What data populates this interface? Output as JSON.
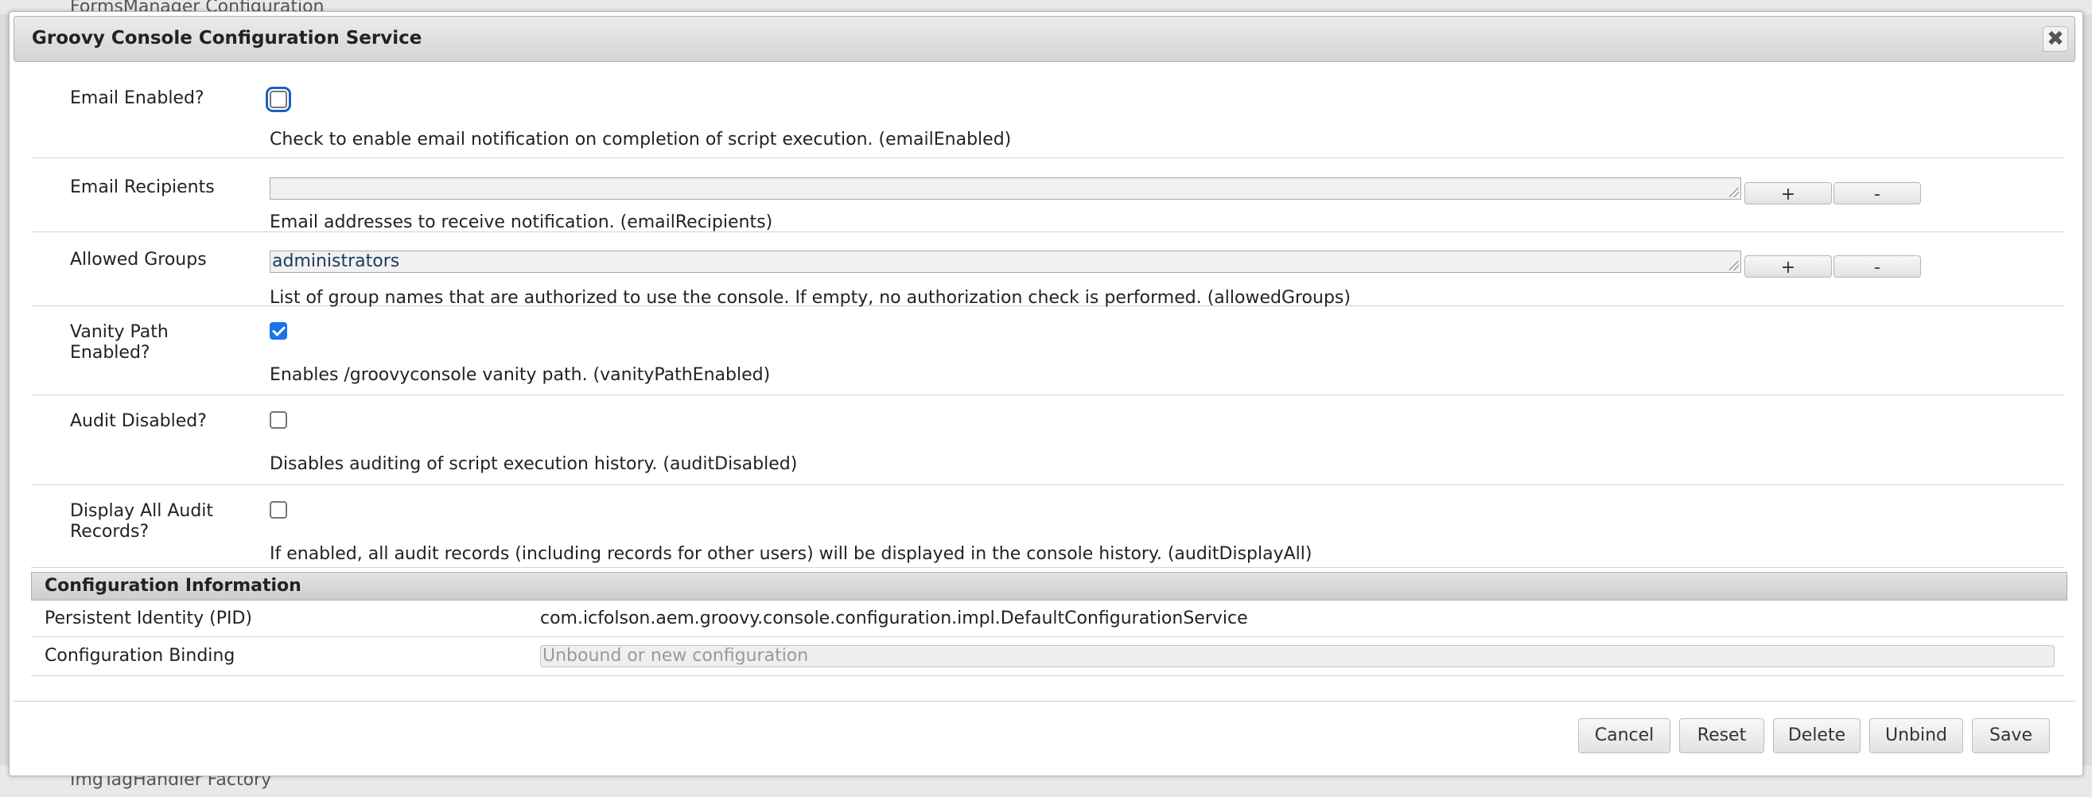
{
  "background": {
    "top_item": "FormsManager Configuration",
    "bottom_item": "ImgTagHandler Factory"
  },
  "dialog": {
    "title": "Groovy Console Configuration Service",
    "close_glyph": "✖"
  },
  "fields": {
    "email_enabled": {
      "label": "Email Enabled?",
      "checked": false,
      "description": "Check to enable email notification on completion of script execution. (emailEnabled)"
    },
    "email_recipients": {
      "label": "Email Recipients",
      "value": "",
      "add_label": "+",
      "remove_label": "-",
      "description": "Email addresses to receive notification. (emailRecipients)"
    },
    "allowed_groups": {
      "label": "Allowed Groups",
      "value": "administrators",
      "add_label": "+",
      "remove_label": "-",
      "description": "List of group names that are authorized to use the console. If empty, no authorization check is performed. (allowedGroups)"
    },
    "vanity_path": {
      "label": "Vanity Path Enabled?",
      "checked": true,
      "description": "Enables /groovyconsole vanity path. (vanityPathEnabled)"
    },
    "audit_disabled": {
      "label": "Audit Disabled?",
      "checked": false,
      "description": "Disables auditing of script execution history. (auditDisabled)"
    },
    "display_all_audit": {
      "label": "Display All Audit Records?",
      "checked": false,
      "description": "If enabled, all audit records (including records for other users) will be displayed in the console history. (auditDisplayAll)"
    }
  },
  "config_info": {
    "heading": "Configuration Information",
    "pid_label": "Persistent Identity (PID)",
    "pid_value": "com.icfolson.aem.groovy.console.configuration.impl.DefaultConfigurationService",
    "binding_label": "Configuration Binding",
    "binding_placeholder": "Unbound or new configuration"
  },
  "buttons": {
    "cancel": "Cancel",
    "reset": "Reset",
    "delete": "Delete",
    "unbind": "Unbind",
    "save": "Save"
  },
  "colors": {
    "accent": "#1a73e8",
    "focus_ring": "#1a5fc8",
    "titlebar": "#dcdcdc"
  }
}
